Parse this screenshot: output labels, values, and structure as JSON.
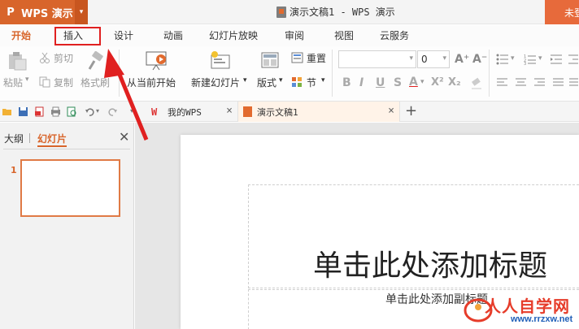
{
  "app": {
    "name": "WPS 演示",
    "logo_glyph": "P",
    "menu_arrow": "▾"
  },
  "window": {
    "title": "演示文稿1 - WPS 演示",
    "login_label": "未登"
  },
  "menu_tabs": {
    "start": "开始",
    "insert": "插入",
    "design": "设计",
    "animation": "动画",
    "slideshow": "幻灯片放映",
    "review": "审阅",
    "view": "视图",
    "cloud": "云服务"
  },
  "ribbon": {
    "paste": "粘贴",
    "cut": "剪切",
    "copy": "复制",
    "format_painter": "格式刷",
    "from_current": "从当前开始",
    "new_slide": "新建幻灯片",
    "layout": "版式",
    "reset": "重置",
    "section": "节",
    "font_size_value": "0",
    "bold": "B",
    "italic": "I",
    "underline": "U",
    "shadow": "S",
    "font_color": "A",
    "superscript": "X²",
    "subscript": "X₂",
    "grow_font": "A⁺",
    "shrink_font": "A⁻"
  },
  "doc_tabs": [
    {
      "label": "我的WPS"
    },
    {
      "label": "演示文稿1"
    }
  ],
  "left_pane": {
    "outline_tab": "大纲",
    "slides_tab": "幻灯片",
    "slide_number": "1"
  },
  "slide": {
    "title_placeholder": "单击此处添加标题",
    "subtitle_placeholder": "单击此处添加副标题"
  },
  "watermark": {
    "brand": "人人自学网",
    "url": "www.rrzxw.net"
  },
  "colors": {
    "accent": "#d8652b",
    "highlight_box": "#e02020",
    "annotation_arrow": "#e02020"
  }
}
